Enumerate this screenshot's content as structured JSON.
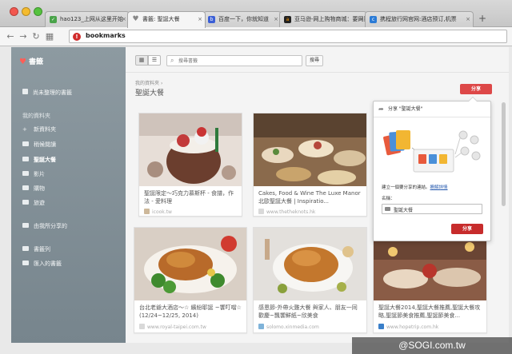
{
  "browser": {
    "tabs": [
      {
        "label": "hao123_上网从这里开始",
        "favicon": "hao123-icon"
      },
      {
        "label": "書籤: 聖誕大餐",
        "favicon": "heart-icon"
      },
      {
        "label": "百度一下，你就知道",
        "favicon": "baidu-icon"
      },
      {
        "label": "亚马逊-网上购物商城：要网购，",
        "favicon": "amazon-icon"
      },
      {
        "label": "携程旅行网官网:酒店预订,机票",
        "favicon": "ctrip-icon"
      }
    ],
    "new_tab": "+",
    "address": "bookmarks"
  },
  "sidebar": {
    "logo": "書籤",
    "unsorted": "尚未整理的書籤",
    "my_folders_heading": "我的資料夾",
    "new_folder": "新資料夾",
    "folders": [
      "稍候閱讀",
      "聖誕大餐",
      "影片",
      "購物",
      "旅遊"
    ],
    "shared_with_me": "由我所分享的",
    "bookmarks_bar": "書籤列",
    "imported": "匯入的書籤"
  },
  "main": {
    "search_placeholder": "搜尋書籤",
    "search_button": "搜尋",
    "breadcrumb": "我的資料夾",
    "breadcrumb_sep": "›",
    "title": "聖誕大餐",
    "share_button": "分享"
  },
  "cards": [
    {
      "title": "聖誕限定～巧克力慕斯杯 - 食譜，作法 - 愛料理",
      "domain": "icook.tw"
    },
    {
      "title": "Cakes, Food & Wine The Luxe Manor 北歐聖誕大餐 | Inspiratio...",
      "domain": "www.thetheknots.hk"
    },
    {
      "title": "台北老爺大酒店～☆ 繽紛耶誕 ~饗叮噹☆ (12/24~12/25, 2014)",
      "domain": "www.royal-taipei.com.tw"
    },
    {
      "title": "感恩節-外帶火雞大餐 與家人、朋友一同歡慶~飄饗鮮紙~欣美食",
      "domain": "solomo.xinmedia.com"
    },
    {
      "title": "聖誕大餐2014,聖誕大餐推薦,聖誕大餐攻略,聖誕節美食推薦,聖誕節美食...",
      "domain": "www.hopetrip.com.hk"
    }
  ],
  "popover": {
    "title": "分享 \"聖誕大餐\"",
    "desc_before": "建立一個要分享的連結。",
    "desc_link": "瞭解詳情",
    "name_label": "名稱：",
    "name_value": "聖誕大餐",
    "share_button": "分享"
  },
  "watermark": "@SOGI.com.tw"
}
